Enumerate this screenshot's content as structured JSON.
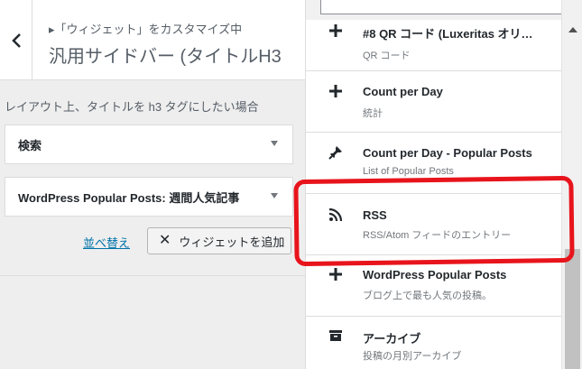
{
  "left": {
    "breadcrumb": "▸「ウィジェット」をカスタマイズ中",
    "section_title": "汎用サイドバー (タイトルH3",
    "description": "レイアウト上、タイトルを h3 タグにしたい場合",
    "widgets": [
      {
        "title": "検索"
      },
      {
        "title": "WordPress Popular Posts: 週間人気記事"
      }
    ],
    "reorder_label": "並べ替え",
    "add_widget_label": "ウィジェットを追加",
    "add_widget_icon": "close-icon"
  },
  "right": {
    "search_value": "",
    "items": [
      {
        "title": "#8 QR コード (Luxeritas オリ…",
        "desc": "QR コード",
        "icon": "plus-icon"
      },
      {
        "title": "Count per Day",
        "desc": "統計",
        "icon": "plus-icon"
      },
      {
        "title": "Count per Day - Popular Posts",
        "desc": "List of Popular Posts",
        "icon": "pin-icon"
      },
      {
        "title": "RSS",
        "desc": "RSS/Atom フィードのエントリー",
        "icon": "rss-icon"
      },
      {
        "title": "WordPress Popular Posts",
        "desc": "ブログ上で最も人気の投稿。",
        "icon": "plus-icon"
      },
      {
        "title": "アーカイブ",
        "desc": "投稿の月別アーカイブ",
        "icon": "archive-icon"
      }
    ]
  },
  "colors": {
    "link": "#0073aa",
    "highlight": "#e8141c"
  }
}
